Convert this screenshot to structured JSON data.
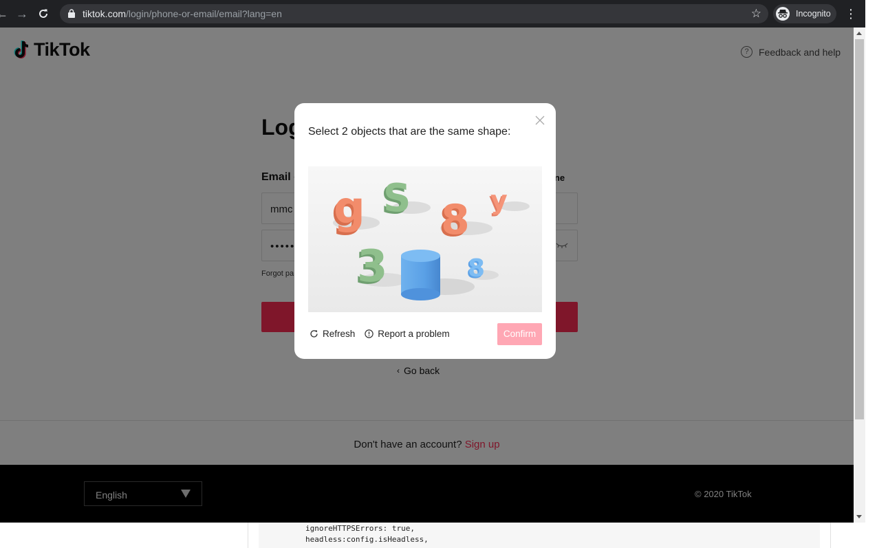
{
  "editor": {
    "code_lines": [
      "ignoreHTTPSErrors: true,",
      "headless:config.isHeadless,"
    ]
  },
  "browser": {
    "url_host": "tiktok.com",
    "url_path": "/login/phone-or-email/email?lang=en",
    "profile_label": "Incognito"
  },
  "header": {
    "logo_text": "TikTok",
    "feedback_label": "Feedback and help"
  },
  "login": {
    "title": "Log",
    "email_label": "Email o",
    "phone_link": "hone",
    "email_value": "mmc",
    "password_value": "••••••",
    "forgot_text": "Forgot pa",
    "go_back": "Go back"
  },
  "signup": {
    "prompt": "Don't have an account?",
    "link": "Sign up"
  },
  "footer": {
    "language": "English",
    "copyright": "© 2020 TikTok"
  },
  "captcha": {
    "prompt": "Select 2 objects that are the same shape:",
    "objects": [
      "g",
      "S",
      "8",
      "y",
      "3",
      "cylinder",
      "8"
    ],
    "refresh_label": "Refresh",
    "report_label": "Report a problem",
    "confirm_label": "Confirm"
  },
  "colors": {
    "brand_red": "#fe2c55",
    "confirm_disabled": "#ffa7b4",
    "chrome_dark": "#202124"
  }
}
